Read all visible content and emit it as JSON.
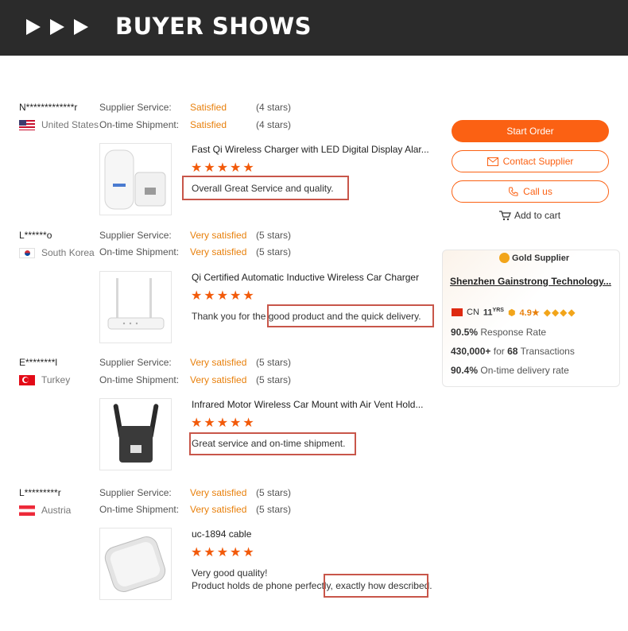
{
  "banner": {
    "title": "BUYER SHOWS"
  },
  "reviews": [
    {
      "buyer": "N*************r",
      "country": "United States",
      "supplier_service_label": "Supplier Service:",
      "supplier_service_value": "Satisfied",
      "supplier_service_stars": "(4 stars)",
      "shipment_label": "On-time Shipment:",
      "shipment_value": "Satisfied",
      "shipment_stars": "(4 stars)",
      "product_title": "Fast Qi Wireless Charger with LED Digital Display Alar...",
      "rating": 5,
      "comment_line1": "Overall Great Service and quality.",
      "comment_line2": ""
    },
    {
      "buyer": "L******o",
      "country": "South Korea",
      "supplier_service_label": "Supplier Service:",
      "supplier_service_value": "Very satisfied",
      "supplier_service_stars": "(5 stars)",
      "shipment_label": "On-time Shipment:",
      "shipment_value": "Very satisfied",
      "shipment_stars": "(5 stars)",
      "product_title": "Qi Certified Automatic Inductive Wireless Car Charger",
      "rating": 5,
      "comment_line1": "Thank you for the good product and the quick delivery.",
      "comment_line2": ""
    },
    {
      "buyer": "E********l",
      "country": "Turkey",
      "supplier_service_label": "Supplier Service:",
      "supplier_service_value": "Very satisfied",
      "supplier_service_stars": "(5 stars)",
      "shipment_label": "On-time Shipment:",
      "shipment_value": "Very satisfied",
      "shipment_stars": "(5 stars)",
      "product_title": "Infrared Motor Wireless Car Mount with Air Vent Hold...",
      "rating": 5,
      "comment_line1": "Great service and on-time shipment.",
      "comment_line2": ""
    },
    {
      "buyer": "L*********r",
      "country": "Austria",
      "supplier_service_label": "Supplier Service:",
      "supplier_service_value": "Very satisfied",
      "supplier_service_stars": "(5 stars)",
      "shipment_label": "On-time Shipment:",
      "shipment_value": "Very satisfied",
      "shipment_stars": "(5 stars)",
      "product_title": "uc-1894 cable",
      "rating": 5,
      "comment_line1": "Very good quality!",
      "comment_line2": "Product holds de phone perfectly, exactly how described."
    }
  ],
  "actions": {
    "start_order": "Start Order",
    "contact_supplier": "Contact Supplier",
    "call_us": "Call us",
    "add_to_cart": "Add to cart"
  },
  "supplier": {
    "badge": "Gold Supplier",
    "company": "Shenzhen Gainstrong Technology...",
    "country_code": "CN",
    "years_num": "11",
    "years_unit": "YRS",
    "score": "4.9",
    "response_rate": "90.5%",
    "response_rate_label": "Response Rate",
    "transactions_amount": "430,000+",
    "transactions_for": "for",
    "transactions_count": "68",
    "transactions_label": "Transactions",
    "ontime_rate": "90.4%",
    "ontime_label": "On-time delivery rate"
  },
  "colors": {
    "accent": "#fb6113",
    "banner": "#2b2b2b",
    "rating_text": "#e8800c",
    "highlight": "#c8564a"
  }
}
